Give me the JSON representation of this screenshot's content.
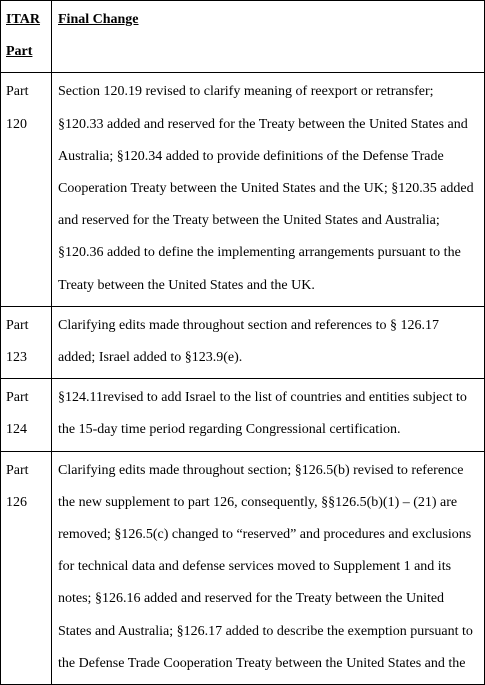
{
  "table": {
    "header": {
      "part_line1": "ITAR",
      "part_line2": "Part",
      "change": "Final Change"
    },
    "rows": [
      {
        "part_line1": "Part",
        "part_line2": "120",
        "lines": [
          "Section 120.19 revised to clarify meaning of reexport or retransfer;",
          "§120.33 added and reserved for the Treaty between the United States and",
          "Australia; §120.34 added to provide definitions of the Defense Trade",
          "Cooperation Treaty between the United States and the UK; §120.35 added",
          "and reserved for the Treaty between the United States and Australia;",
          "§120.36 added to define the implementing arrangements pursuant to the",
          "Treaty between the United States and the UK."
        ]
      },
      {
        "part_line1": "Part",
        "part_line2": "123",
        "lines": [
          "Clarifying edits made throughout section and references to § 126.17",
          "added; Israel added to §123.9(e)."
        ]
      },
      {
        "part_line1": "Part",
        "part_line2": "124",
        "lines": [
          "§124.11revised to add Israel to the list of countries and entities subject to",
          "the 15-day time period regarding Congressional certification."
        ]
      },
      {
        "part_line1": "Part",
        "part_line2": "126",
        "lines": [
          "Clarifying edits made throughout section; §126.5(b) revised to reference",
          "the new supplement to part 126, consequently, §§126.5(b)(1) – (21) are",
          "removed; §126.5(c) changed to “reserved” and procedures and exclusions",
          "for technical data and defense services moved to Supplement 1 and its",
          "notes; §126.16 added and reserved for the Treaty between the United",
          "States and Australia; §126.17 added to describe the exemption pursuant to",
          "the Defense Trade Cooperation Treaty between the United States and the"
        ]
      }
    ]
  }
}
